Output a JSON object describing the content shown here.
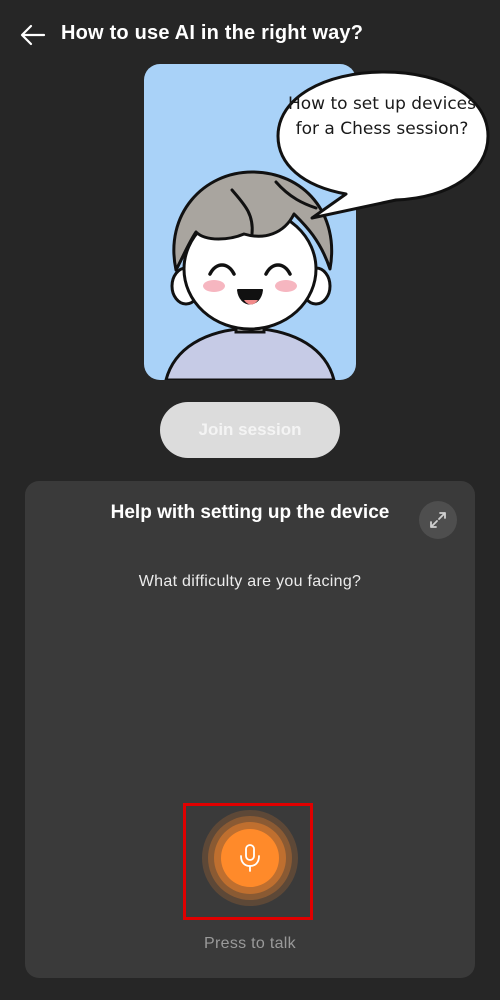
{
  "header": {
    "title": "How to use AI in the right way?",
    "back_icon": "arrow-left-icon"
  },
  "avatar": {
    "speech": "How to set up devices for a Chess session?",
    "background_color": "#a9d2f8"
  },
  "join_button": {
    "label": "Join session"
  },
  "help_panel": {
    "title": "Help with setting up the device",
    "question": "What difficulty are you facing?",
    "expand_icon": "expand-icon",
    "mic_icon": "microphone-icon",
    "press_label": "Press to talk",
    "accent_color": "#ff8a2a"
  }
}
